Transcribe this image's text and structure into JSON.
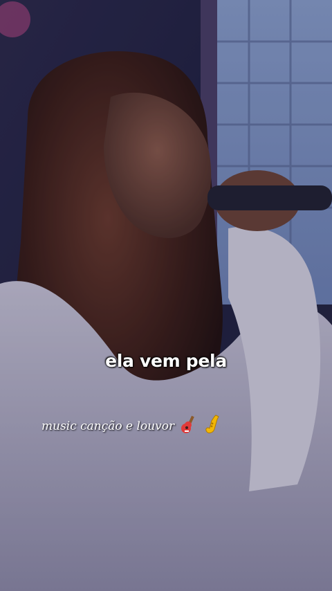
{
  "video": {
    "subtitle": "ela vem pela",
    "watermark": "music canção e louvor",
    "watermark_icons": [
      "guitar-icon",
      "saxophone-icon"
    ]
  }
}
